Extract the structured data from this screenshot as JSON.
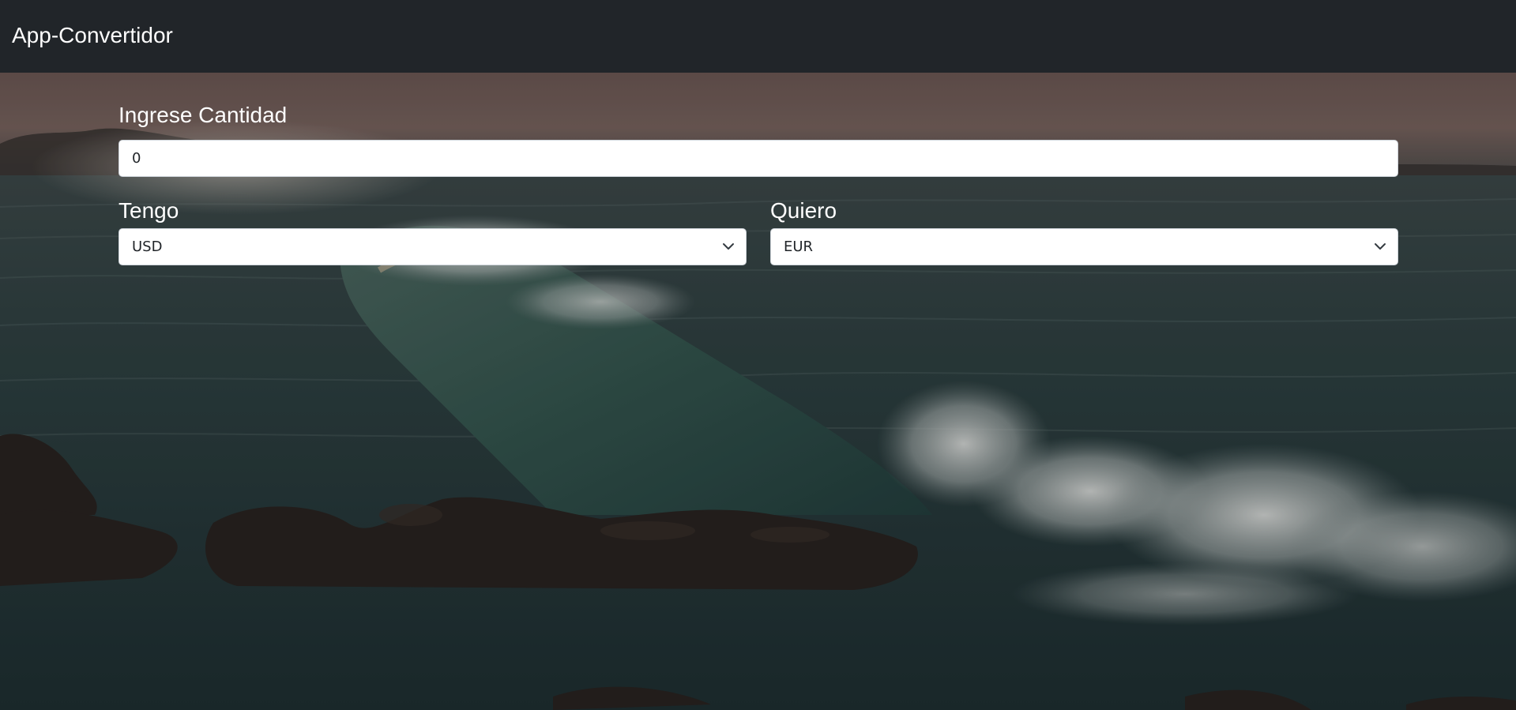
{
  "navbar": {
    "brand": "App-Convertidor"
  },
  "form": {
    "amount_label": "Ingrese Cantidad",
    "amount_value": "0",
    "from_label": "Tengo",
    "from_value": "USD",
    "to_label": "Quiero",
    "to_value": "EUR"
  },
  "background": {
    "icon": "ocean-wave-photo-icon"
  },
  "colors": {
    "navbar": "#212529",
    "text_on_dark": "#ffffff"
  }
}
